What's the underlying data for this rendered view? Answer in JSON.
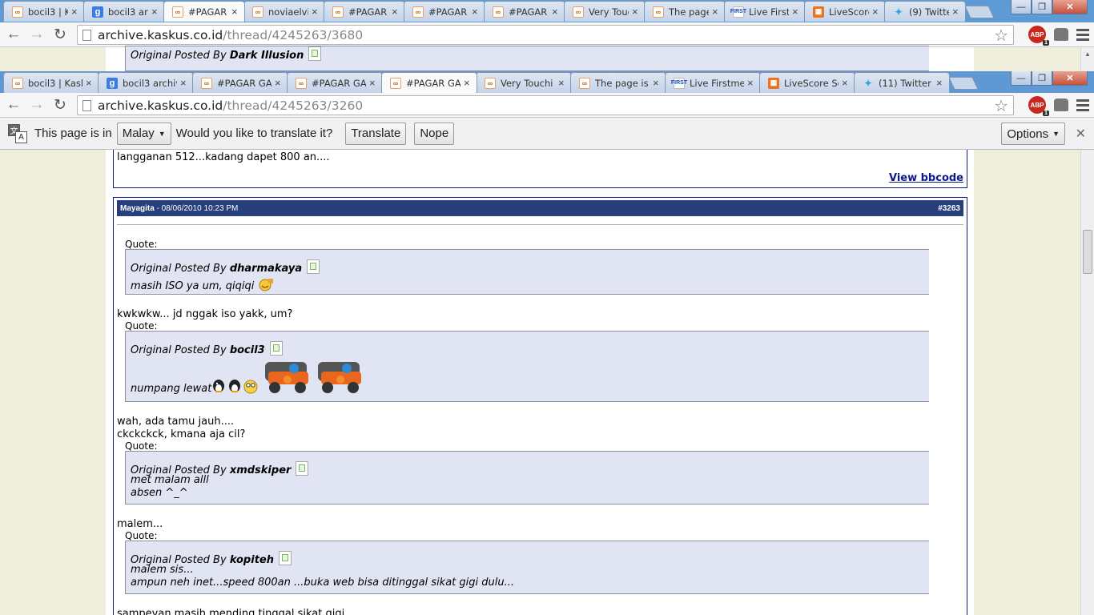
{
  "colors": {
    "tabstrip": "#5e9ad3",
    "page_bg": "#efeedd",
    "post_header": "#263e7c",
    "quote_bg": "#e1e4f2",
    "link": "#0b198c"
  },
  "back_window": {
    "tabs": [
      {
        "icon": "kaskus-favicon",
        "title": "bocil3 | Kask"
      },
      {
        "icon": "google-favicon",
        "title": "bocil3 archive"
      },
      {
        "icon": "kaskus-favicon",
        "title": "#PAGAR GA",
        "active": true
      },
      {
        "icon": "kaskus-favicon",
        "title": "noviaelvi"
      },
      {
        "icon": "kaskus-favicon",
        "title": "#PAGAR GA"
      },
      {
        "icon": "kaskus-favicon",
        "title": "#PAGAR GA"
      },
      {
        "icon": "kaskus-favicon",
        "title": "#PAGAR GA"
      },
      {
        "icon": "kaskus-favicon",
        "title": "Very Touching"
      },
      {
        "icon": "kaskus-favicon",
        "title": "The page is"
      },
      {
        "icon": "first-favicon",
        "title": "Live Firstme"
      },
      {
        "icon": "livescore-favicon",
        "title": "LiveScore So"
      },
      {
        "icon": "twitter-favicon",
        "title": "(9) Twitter"
      }
    ],
    "url_host": "archive.kaskus.co.id",
    "url_path": "/thread/4245263/3680",
    "peek_quote": {
      "prefix": "Original Posted By",
      "author": "Dark Illusion"
    }
  },
  "front_window": {
    "tabs": [
      {
        "icon": "kaskus-favicon",
        "title": "bocil3 | Kask"
      },
      {
        "icon": "google-favicon",
        "title": "bocil3 archiv"
      },
      {
        "icon": "kaskus-favicon",
        "title": "#PAGAR GA"
      },
      {
        "icon": "kaskus-favicon",
        "title": "#PAGAR GA"
      },
      {
        "icon": "kaskus-favicon",
        "title": "#PAGAR GA",
        "active": true
      },
      {
        "icon": "kaskus-favicon",
        "title": "Very Touchi"
      },
      {
        "icon": "kaskus-favicon",
        "title": "The page is"
      },
      {
        "icon": "first-favicon",
        "title": "Live Firstme"
      },
      {
        "icon": "livescore-favicon",
        "title": "LiveScore So"
      },
      {
        "icon": "twitter-favicon",
        "title": "(11) Twitter"
      }
    ],
    "url_host": "archive.kaskus.co.id",
    "url_path": "/thread/4245263/3260",
    "abp_count": "1"
  },
  "translate_bar": {
    "prefix": "This page is in",
    "language": "Malay",
    "question": "Would you like to translate it?",
    "translate_label": "Translate",
    "nope_label": "Nope",
    "options_label": "Options"
  },
  "prev_post": {
    "tail_text": "langganan 512...kadang dapet 800 an....",
    "bbcode_link": "View bbcode"
  },
  "post": {
    "author": "Mayagita",
    "date": "- 08/06/2010 10:23 PM",
    "number": "#3263",
    "quote_label": "Quote:",
    "quotes": [
      {
        "prefix": "Original Posted By",
        "author": "dharmakaya",
        "lines": [
          "masih ISO ya um, qiqiqi"
        ]
      },
      {
        "prefix": "Original Posted By",
        "author": "bocil3",
        "lines": [
          "numpang lewat"
        ]
      },
      {
        "prefix": "Original Posted By",
        "author": "xmdskiper",
        "lines": [
          "met malam alll",
          "absen ^_^"
        ]
      },
      {
        "prefix": "Original Posted By",
        "author": "kopiteh",
        "lines": [
          "malem sis...",
          "ampun neh inet...speed 800an ...buka web bisa ditinggal sikat gigi dulu..."
        ]
      }
    ],
    "replies": [
      "kwkwkw... jd nggak iso yakk, um?",
      "wah, ada tamu jauh....",
      "ckckckck, kmana aja cil?",
      "malem...",
      "sampeyan masih mending tinggal sikat gigi"
    ]
  }
}
